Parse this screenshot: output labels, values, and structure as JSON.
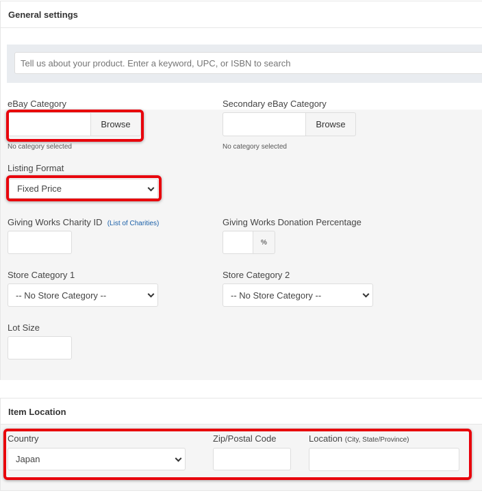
{
  "general": {
    "title": "General settings",
    "search_placeholder": "Tell us about your product. Enter a keyword, UPC, or ISBN to search",
    "ebay_category": {
      "label": "eBay Category",
      "button": "Browse",
      "status": "No category selected"
    },
    "secondary_category": {
      "label": "Secondary eBay Category",
      "button": "Browse",
      "status": "No category selected"
    },
    "listing_format": {
      "label": "Listing Format",
      "value": "Fixed Price"
    },
    "charity": {
      "label": "Giving Works Charity ID",
      "link": "(List of Charities)"
    },
    "donation": {
      "label": "Giving Works Donation Percentage",
      "suffix": "%"
    },
    "store1": {
      "label": "Store Category 1",
      "value": "-- No Store Category --"
    },
    "store2": {
      "label": "Store Category 2",
      "value": "-- No Store Category --"
    },
    "lot_size": {
      "label": "Lot Size"
    }
  },
  "location": {
    "title": "Item Location",
    "country": {
      "label": "Country",
      "value": "Japan"
    },
    "zip": {
      "label": "Zip/Postal Code"
    },
    "loc": {
      "label": "Location",
      "hint": "(City, State/Province)"
    }
  },
  "colors": {
    "highlight": "#e8000b",
    "link": "#1a5fa8"
  }
}
